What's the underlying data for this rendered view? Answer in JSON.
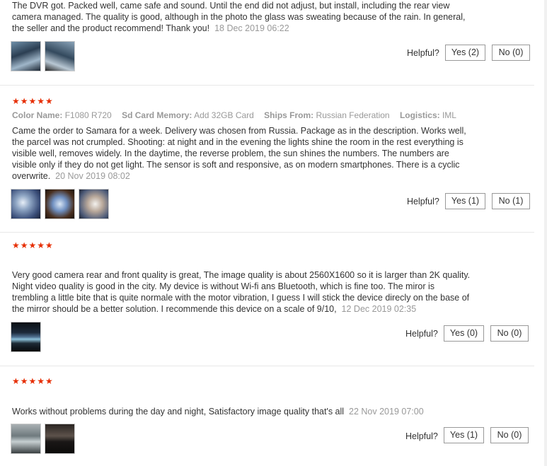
{
  "reviews": [
    {
      "text": "The DVR got. Packed well, came safe and sound. Until the end did not adjust, but install, including the rear view camera managed. The quality is good, although in the photo the glass was sweating because of the rain. In general, the seller and the product recommend! Thank you!",
      "date": "18 Dec 2019 06:22",
      "helpful_label": "Helpful?",
      "yes_label": "Yes (2)",
      "no_label": "No (0)"
    },
    {
      "stars": "★★★★★",
      "attrs": {
        "color_key": "Color Name:",
        "color_val": "F1080 R720",
        "sd_key": "Sd Card Memory:",
        "sd_val": "Add 32GB Card",
        "ships_key": "Ships From:",
        "ships_val": "Russian Federation",
        "log_key": "Logistics:",
        "log_val": "IML"
      },
      "text": "Came the order to Samara for a week. Delivery was chosen from Russia. Package as in the description. Works well, the parcel was not crumpled. Shooting: at night and in the evening the lights shine the room in the rest everything is visible well, removes widely. In the daytime, the reverse problem, the sun shines the numbers. The numbers are visible only if they do not get light. The sensor is soft and responsive, as on modern smartphones. There is a cyclic overwrite.",
      "date": "20 Nov 2019 08:02",
      "helpful_label": "Helpful?",
      "yes_label": "Yes (1)",
      "no_label": "No (1)"
    },
    {
      "stars": "★★★★★",
      "text": "Very good camera rear and front quality is great, The image quality is about 2560X1600 so it is larger than 2K quality. Night video quality is good in the city. My device is without Wi-fi ans Bluetooth, which is fine too. The miror is trembling a little bite that is quite normale with the motor vibration, I guess I will stick the device direcly on the base of the mirror should be a better solution. I recommende this device on a scale of 9/10,",
      "date": "12 Dec 2019 02:35",
      "helpful_label": "Helpful?",
      "yes_label": "Yes (0)",
      "no_label": "No (0)"
    },
    {
      "stars": "★★★★★",
      "text": "Works without problems during the day and night, Satisfactory image quality that's all",
      "date": "22 Nov 2019 07:00",
      "helpful_label": "Helpful?",
      "yes_label": "Yes (1)",
      "no_label": "No (0)"
    }
  ],
  "colors": {
    "star": "#e62e04",
    "meta": "#999999",
    "border": "#999999"
  }
}
